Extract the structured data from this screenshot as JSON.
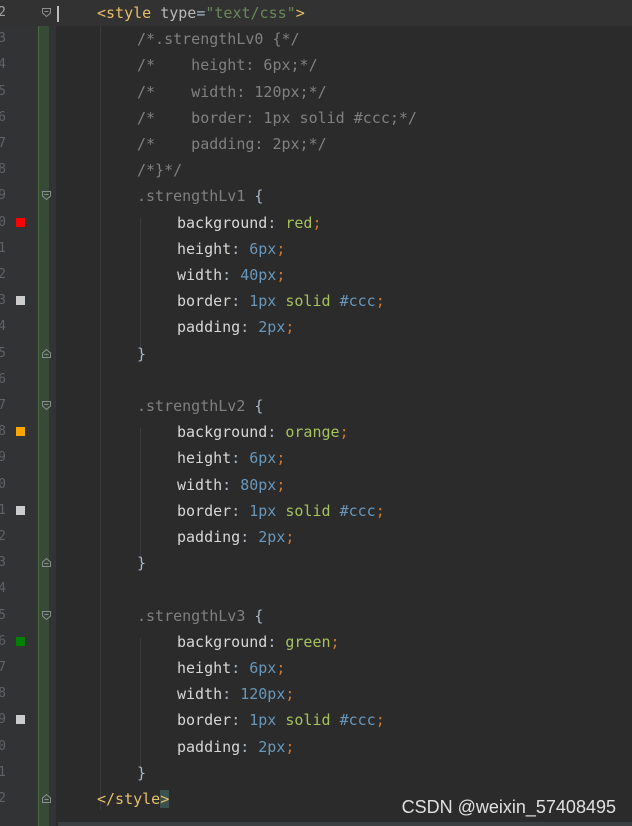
{
  "colors": {
    "background": "#2b2b2b",
    "gutter": "#313335",
    "vcs_changed": "#374a37"
  },
  "lines": [
    {
      "ln": "2",
      "current": true,
      "fold": "open",
      "swatch": null,
      "tokens": [
        {
          "t": "<style",
          "c": "tag"
        },
        {
          "t": " ",
          "c": "plain"
        },
        {
          "t": "type",
          "c": "attr"
        },
        {
          "t": "=",
          "c": "plain"
        },
        {
          "t": "\"text/css\"",
          "c": "str"
        },
        {
          "t": ">",
          "c": "tag"
        }
      ]
    },
    {
      "ln": "3",
      "indent": 1,
      "tokens": [
        {
          "t": "/*.strengthLv0 {*/",
          "c": "comment"
        }
      ]
    },
    {
      "ln": "4",
      "indent": 1,
      "tokens": [
        {
          "t": "/*    height: 6px;*/",
          "c": "comment"
        }
      ]
    },
    {
      "ln": "5",
      "indent": 1,
      "tokens": [
        {
          "t": "/*    width: 120px;*/",
          "c": "comment"
        }
      ]
    },
    {
      "ln": "6",
      "indent": 1,
      "tokens": [
        {
          "t": "/*    border: 1px solid #ccc;*/",
          "c": "comment"
        }
      ]
    },
    {
      "ln": "7",
      "indent": 1,
      "tokens": [
        {
          "t": "/*    padding: 2px;*/",
          "c": "comment"
        }
      ]
    },
    {
      "ln": "8",
      "indent": 1,
      "tokens": [
        {
          "t": "/*}*/",
          "c": "comment"
        }
      ]
    },
    {
      "ln": "9",
      "indent": 1,
      "fold": "open",
      "tokens": [
        {
          "t": ".strengthLv1",
          "c": "selector"
        },
        {
          "t": " {",
          "c": "plain"
        }
      ]
    },
    {
      "ln": "0",
      "indent": 2,
      "swatch": "#ff0000",
      "tokens": [
        {
          "t": "background",
          "c": "prop"
        },
        {
          "t": ": ",
          "c": "plain"
        },
        {
          "t": "red",
          "c": "kwval"
        },
        {
          "t": ";",
          "c": "punc"
        }
      ]
    },
    {
      "ln": "1",
      "indent": 2,
      "tokens": [
        {
          "t": "height",
          "c": "prop"
        },
        {
          "t": ": ",
          "c": "plain"
        },
        {
          "t": "6",
          "c": "num"
        },
        {
          "t": "px",
          "c": "num"
        },
        {
          "t": ";",
          "c": "punc"
        }
      ]
    },
    {
      "ln": "2",
      "indent": 2,
      "tokens": [
        {
          "t": "width",
          "c": "prop"
        },
        {
          "t": ": ",
          "c": "plain"
        },
        {
          "t": "40",
          "c": "num"
        },
        {
          "t": "px",
          "c": "num"
        },
        {
          "t": ";",
          "c": "punc"
        }
      ]
    },
    {
      "ln": "3",
      "indent": 2,
      "swatch": "#cccccc",
      "tokens": [
        {
          "t": "border",
          "c": "prop"
        },
        {
          "t": ": ",
          "c": "plain"
        },
        {
          "t": "1px",
          "c": "num"
        },
        {
          "t": " ",
          "c": "plain"
        },
        {
          "t": "solid",
          "c": "kwval"
        },
        {
          "t": " ",
          "c": "plain"
        },
        {
          "t": "#ccc",
          "c": "num"
        },
        {
          "t": ";",
          "c": "punc"
        }
      ]
    },
    {
      "ln": "4",
      "indent": 2,
      "tokens": [
        {
          "t": "padding",
          "c": "prop"
        },
        {
          "t": ": ",
          "c": "plain"
        },
        {
          "t": "2px",
          "c": "num"
        },
        {
          "t": ";",
          "c": "punc"
        }
      ]
    },
    {
      "ln": "5",
      "indent": 1,
      "fold": "close",
      "tokens": [
        {
          "t": "}",
          "c": "plain"
        }
      ]
    },
    {
      "ln": "6",
      "indent": 0,
      "tokens": []
    },
    {
      "ln": "7",
      "indent": 1,
      "fold": "open",
      "tokens": [
        {
          "t": ".strengthLv2",
          "c": "selector"
        },
        {
          "t": " {",
          "c": "plain"
        }
      ]
    },
    {
      "ln": "8",
      "indent": 2,
      "swatch": "#ffa500",
      "tokens": [
        {
          "t": "background",
          "c": "prop"
        },
        {
          "t": ": ",
          "c": "plain"
        },
        {
          "t": "orange",
          "c": "kwval"
        },
        {
          "t": ";",
          "c": "punc"
        }
      ]
    },
    {
      "ln": "9",
      "indent": 2,
      "tokens": [
        {
          "t": "height",
          "c": "prop"
        },
        {
          "t": ": ",
          "c": "plain"
        },
        {
          "t": "6px",
          "c": "num"
        },
        {
          "t": ";",
          "c": "punc"
        }
      ]
    },
    {
      "ln": "0",
      "indent": 2,
      "tokens": [
        {
          "t": "width",
          "c": "prop"
        },
        {
          "t": ": ",
          "c": "plain"
        },
        {
          "t": "80px",
          "c": "num"
        },
        {
          "t": ";",
          "c": "punc"
        }
      ]
    },
    {
      "ln": "1",
      "indent": 2,
      "swatch": "#cccccc",
      "tokens": [
        {
          "t": "border",
          "c": "prop"
        },
        {
          "t": ": ",
          "c": "plain"
        },
        {
          "t": "1px",
          "c": "num"
        },
        {
          "t": " ",
          "c": "plain"
        },
        {
          "t": "solid",
          "c": "kwval"
        },
        {
          "t": " ",
          "c": "plain"
        },
        {
          "t": "#ccc",
          "c": "num"
        },
        {
          "t": ";",
          "c": "punc"
        }
      ]
    },
    {
      "ln": "2",
      "indent": 2,
      "tokens": [
        {
          "t": "padding",
          "c": "prop"
        },
        {
          "t": ": ",
          "c": "plain"
        },
        {
          "t": "2px",
          "c": "num"
        },
        {
          "t": ";",
          "c": "punc"
        }
      ]
    },
    {
      "ln": "3",
      "indent": 1,
      "fold": "close",
      "tokens": [
        {
          "t": "}",
          "c": "plain"
        }
      ]
    },
    {
      "ln": "4",
      "indent": 0,
      "tokens": []
    },
    {
      "ln": "5",
      "indent": 1,
      "fold": "open",
      "tokens": [
        {
          "t": ".strengthLv3",
          "c": "selector"
        },
        {
          "t": " {",
          "c": "plain"
        }
      ]
    },
    {
      "ln": "6",
      "indent": 2,
      "swatch": "#008000",
      "tokens": [
        {
          "t": "background",
          "c": "prop"
        },
        {
          "t": ": ",
          "c": "plain"
        },
        {
          "t": "green",
          "c": "kwval"
        },
        {
          "t": ";",
          "c": "punc"
        }
      ]
    },
    {
      "ln": "7",
      "indent": 2,
      "tokens": [
        {
          "t": "height",
          "c": "prop"
        },
        {
          "t": ": ",
          "c": "plain"
        },
        {
          "t": "6px",
          "c": "num"
        },
        {
          "t": ";",
          "c": "punc"
        }
      ]
    },
    {
      "ln": "8",
      "indent": 2,
      "tokens": [
        {
          "t": "width",
          "c": "prop"
        },
        {
          "t": ": ",
          "c": "plain"
        },
        {
          "t": "120px",
          "c": "num"
        },
        {
          "t": ";",
          "c": "punc"
        }
      ]
    },
    {
      "ln": "9",
      "indent": 2,
      "swatch": "#cccccc",
      "tokens": [
        {
          "t": "border",
          "c": "prop"
        },
        {
          "t": ": ",
          "c": "plain"
        },
        {
          "t": "1px",
          "c": "num"
        },
        {
          "t": " ",
          "c": "plain"
        },
        {
          "t": "solid",
          "c": "kwval"
        },
        {
          "t": " ",
          "c": "plain"
        },
        {
          "t": "#ccc",
          "c": "num"
        },
        {
          "t": ";",
          "c": "punc"
        }
      ]
    },
    {
      "ln": "0",
      "indent": 2,
      "tokens": [
        {
          "t": "padding",
          "c": "prop"
        },
        {
          "t": ": ",
          "c": "plain"
        },
        {
          "t": "2px",
          "c": "num"
        },
        {
          "t": ";",
          "c": "punc"
        }
      ]
    },
    {
      "ln": "1",
      "indent": 1,
      "tokens": [
        {
          "t": "}",
          "c": "plain"
        }
      ]
    },
    {
      "ln": "2",
      "indent": 0,
      "fold": "close",
      "tokens": [
        {
          "t": "</style",
          "c": "tag"
        },
        {
          "t": ">",
          "c": "tag-bracket-hl"
        }
      ]
    }
  ],
  "watermark": "CSDN @weixin_57408495"
}
